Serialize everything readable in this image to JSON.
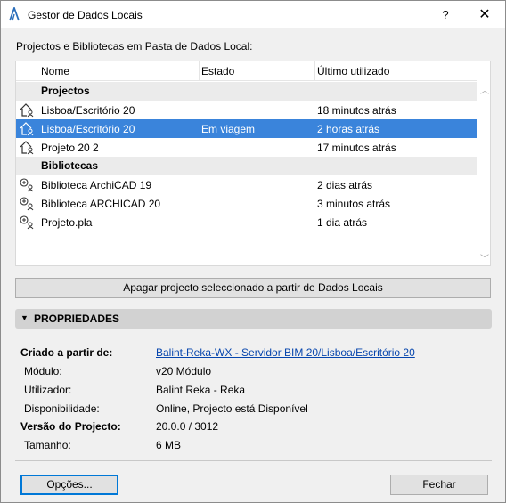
{
  "window": {
    "title": "Gestor de Dados Locais",
    "help": "?",
    "close": "✕"
  },
  "section_label": "Projectos e Bibliotecas em Pasta de Dados Local:",
  "list": {
    "columns": [
      "Nome",
      "Estado",
      "Último utilizado"
    ],
    "groups": [
      {
        "label": "Projectos",
        "rows": [
          {
            "name": "Lisboa/Escritório 20",
            "state": "",
            "last": "18 minutos atrás",
            "icon": "project-icon",
            "selected": false
          },
          {
            "name": "Lisboa/Escritório 20",
            "state": "Em viagem",
            "last": "2 horas atrás",
            "icon": "project-icon",
            "selected": true
          },
          {
            "name": "Projeto 20 2",
            "state": "",
            "last": "17 minutos atrás",
            "icon": "project-icon",
            "selected": false
          }
        ]
      },
      {
        "label": "Bibliotecas",
        "rows": [
          {
            "name": "Biblioteca ArchiCAD 19",
            "state": "",
            "last": "2 dias atrás",
            "icon": "library-icon",
            "selected": false
          },
          {
            "name": "Biblioteca ARCHICAD 20",
            "state": "",
            "last": "3 minutos atrás",
            "icon": "library-icon",
            "selected": false
          },
          {
            "name": "Projeto.pla",
            "state": "",
            "last": "1 dia atrás",
            "icon": "library-icon",
            "selected": false
          }
        ]
      }
    ]
  },
  "delete_button": "Apagar projecto seleccionado a partir de Dados Locais",
  "properties": {
    "title": "PROPRIEDADES",
    "items": [
      {
        "label": "Criado a partir de:",
        "value": "Balint-Reka-WX - Servidor BIM 20/Lisboa/Escritório 20",
        "bold": true,
        "link": true
      },
      {
        "label": "Módulo:",
        "value": "v20 Módulo",
        "bold": false,
        "link": false
      },
      {
        "label": "Utilizador:",
        "value": "Balint Reka - Reka",
        "bold": false,
        "link": false
      },
      {
        "label": "Disponibilidade:",
        "value": "Online, Projecto está Disponível",
        "bold": false,
        "link": false
      },
      {
        "label": "Versão do Projecto:",
        "value": "20.0.0 / 3012",
        "bold": true,
        "link": false
      },
      {
        "label": "Tamanho:",
        "value": "6 MB",
        "bold": false,
        "link": false
      }
    ]
  },
  "footer": {
    "options": "Opções...",
    "close": "Fechar"
  },
  "colors": {
    "selection": "#3a84db",
    "link": "#0645ad",
    "focus": "#0078d7"
  }
}
